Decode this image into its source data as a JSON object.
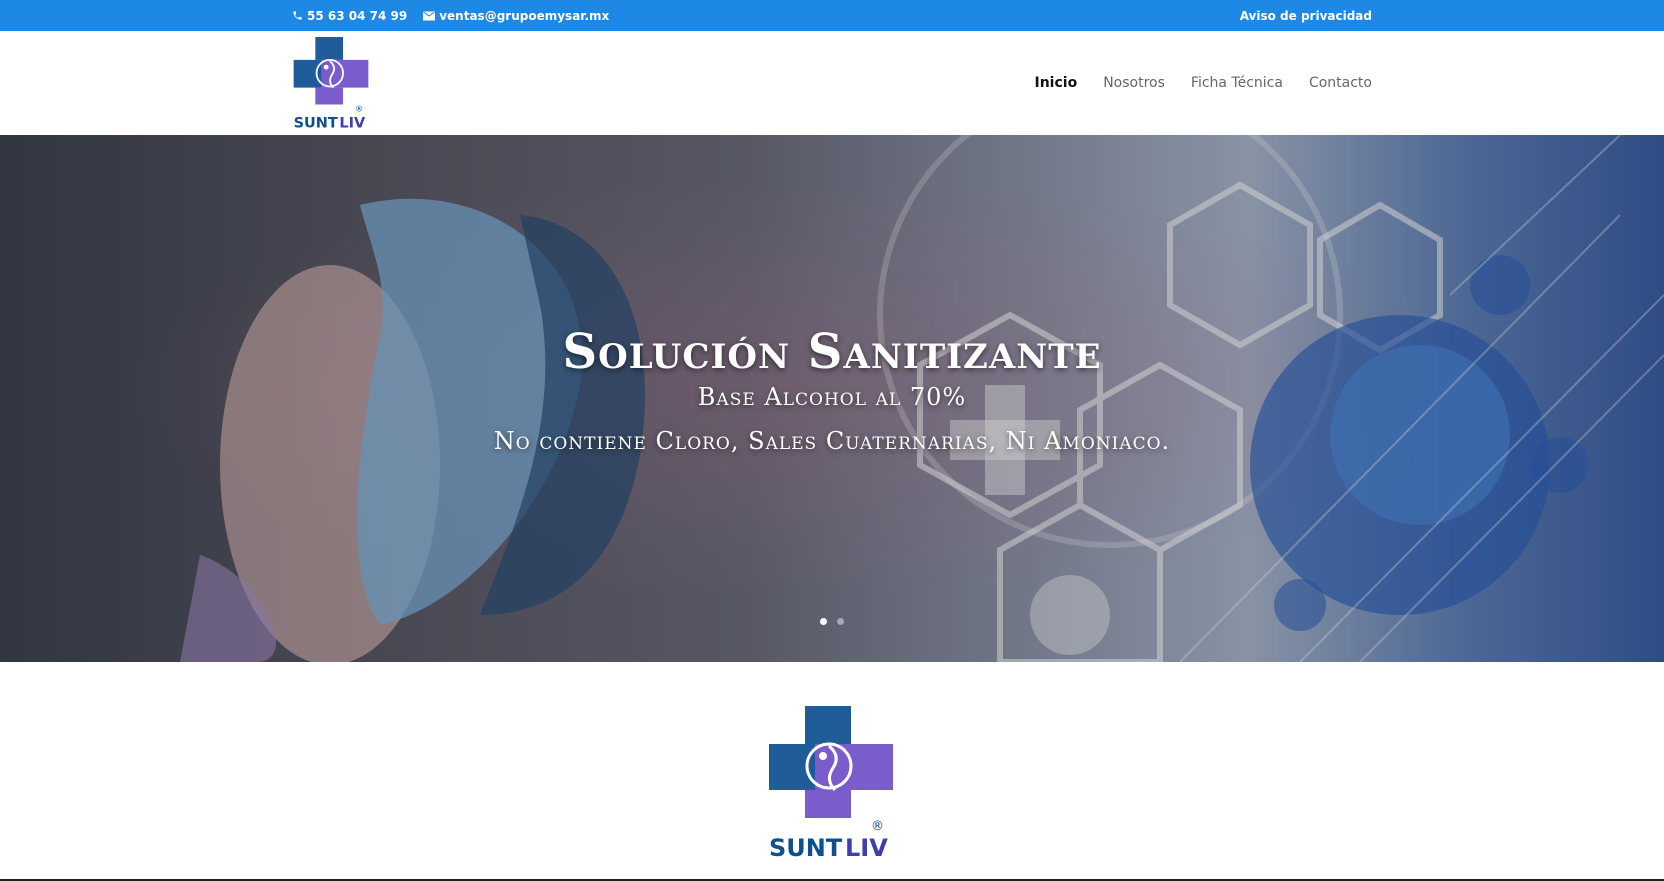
{
  "topbar": {
    "phone": "55 63 04 74 99",
    "email": "ventas@grupoemysar.mx",
    "privacy_link": "Aviso de privacidad",
    "phone_icon": "phone-icon",
    "email_icon": "envelope-icon"
  },
  "brand": {
    "name": "SUNT LIV",
    "registered": "®",
    "colors": {
      "cross_blue": "#1f5c99",
      "cross_purple": "#7a5ccc",
      "text_blue": "#0d4f8f",
      "top_bar": "#1e88e5"
    }
  },
  "nav": {
    "items": [
      {
        "label": "Inicio",
        "active": true
      },
      {
        "label": "Nosotros",
        "active": false
      },
      {
        "label": "Ficha Técnica",
        "active": false
      },
      {
        "label": "Contacto",
        "active": false
      }
    ]
  },
  "hero": {
    "title": "Solución Sanitizante",
    "subtitle": "Base Alcohol al 70%",
    "tagline": "No contiene Cloro, Sales Cuaternarias, Ni Amoniaco.",
    "slides_total": 2,
    "active_slide": 1
  }
}
